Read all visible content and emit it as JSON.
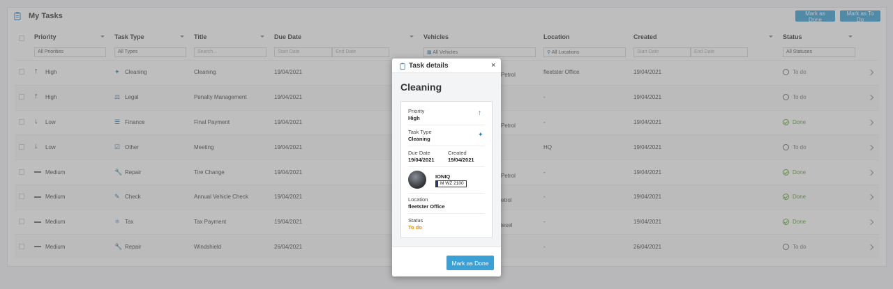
{
  "panel": {
    "title": "My Tasks",
    "mark_done_label": "Mark as Done",
    "mark_todo_label": "Mark as To Do"
  },
  "columns": [
    "Priority",
    "Task Type",
    "Title",
    "Due Date",
    "Vehicles",
    "Location",
    "Created",
    "Status"
  ],
  "filters": {
    "priority": "All Priorities",
    "type": "All Types",
    "title_placeholder": "Search...",
    "due_start": "Start Date",
    "due_end": "End Date",
    "vehicles": "All Vehicles",
    "location": "All Locations",
    "created_start": "Start Date",
    "created_end": "End Date",
    "status": "All Statuses"
  },
  "rows": [
    {
      "priority": "High",
      "priority_icon": "arrow-up",
      "type": "Cleaning",
      "title": "Cleaning",
      "due": "19/04/2021",
      "vehicle_tail": "Petrol",
      "location": "fleetster Office",
      "created": "19/04/2021",
      "status": "To do"
    },
    {
      "priority": "High",
      "priority_icon": "arrow-up",
      "type": "Legal",
      "title": "Penalty Management",
      "due": "19/04/2021",
      "vehicle_tail": "",
      "location": "-",
      "created": "19/04/2021",
      "status": "To do"
    },
    {
      "priority": "Low",
      "priority_icon": "arrow-down",
      "type": "Finance",
      "title": "Final Payment",
      "due": "19/04/2021",
      "vehicle_tail": "Petrol",
      "location": "-",
      "created": "19/04/2021",
      "status": "Done"
    },
    {
      "priority": "Low",
      "priority_icon": "arrow-down",
      "type": "Other",
      "title": "Meeting",
      "due": "19/04/2021",
      "vehicle_tail": "",
      "location": "HQ",
      "created": "19/04/2021",
      "status": "To do"
    },
    {
      "priority": "Medium",
      "priority_icon": "dash",
      "type": "Repair",
      "title": "Tire Change",
      "due": "19/04/2021",
      "vehicle_tail": "Petrol",
      "location": "-",
      "created": "19/04/2021",
      "status": "Done"
    },
    {
      "priority": "Medium",
      "priority_icon": "dash",
      "type": "Check",
      "title": "Annual Vehicle Check",
      "due": "19/04/2021",
      "vehicle_tail": "etrol",
      "location": "-",
      "created": "19/04/2021",
      "status": "Done"
    },
    {
      "priority": "Medium",
      "priority_icon": "dash",
      "type": "Tax",
      "title": "Tax Payment",
      "due": "19/04/2021",
      "vehicle_tail": "iesel",
      "location": "-",
      "created": "19/04/2021",
      "status": "Done"
    },
    {
      "priority": "Medium",
      "priority_icon": "dash",
      "type": "Repair",
      "title": "Windshield",
      "due": "26/04/2021",
      "vehicle_tail": "",
      "location": "-",
      "created": "26/04/2021",
      "status": "To do"
    }
  ],
  "modal": {
    "header": "Task details",
    "close": "×",
    "title": "Cleaning",
    "priority_label": "Priority",
    "priority_value": "High",
    "type_label": "Task Type",
    "type_value": "Cleaning",
    "due_label": "Due Date",
    "due_value": "19/04/2021",
    "created_label": "Created",
    "created_value": "19/04/2021",
    "vehicle_name": "IONIQ",
    "vehicle_plate": "M WZ 2100",
    "location_label": "Location",
    "location_value": "fleetster Office",
    "status_label": "Status",
    "status_value": "To do",
    "button": "Mark as Done"
  },
  "colors": {
    "accent": "#3aa0d5",
    "done": "#5aa02c",
    "todo_status": "#f08c00",
    "icon_blue": "#2a7ab3"
  }
}
